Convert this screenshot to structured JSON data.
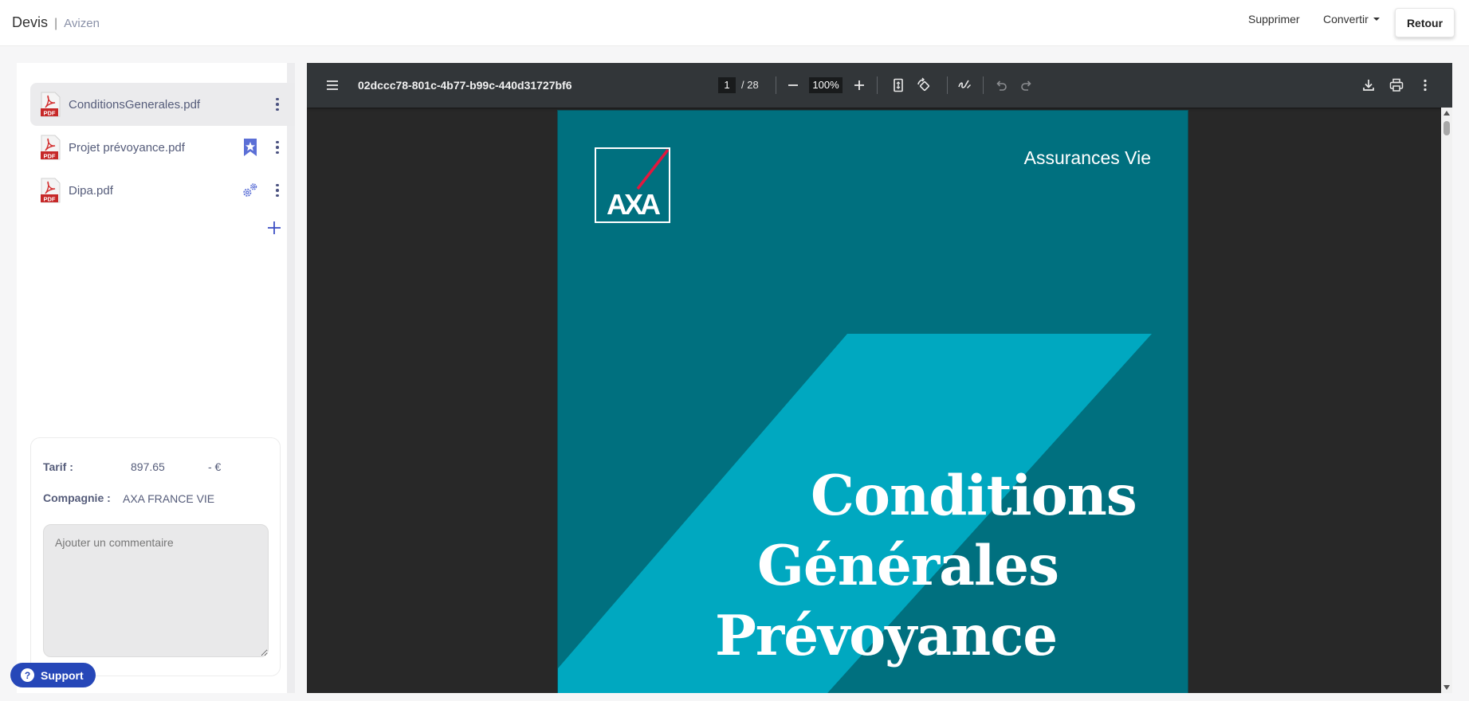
{
  "header": {
    "title": "Devis",
    "separator": "|",
    "subtitle": "Avizen",
    "delete_label": "Supprimer",
    "convert_label": "Convertir",
    "back_label": "Retour"
  },
  "files": [
    {
      "name": "ConditionsGenerales.pdf",
      "active": true,
      "status_icon": ""
    },
    {
      "name": "Projet prévoyance.pdf",
      "active": false,
      "status_icon": "bookmark-star-icon"
    },
    {
      "name": "Dipa.pdf",
      "active": false,
      "status_icon": "gears-icon"
    }
  ],
  "info": {
    "tarif_label": "Tarif :",
    "tarif_value": "897.65",
    "tarif_suffix": "- €",
    "compagnie_label": "Compagnie :",
    "compagnie_value": "AXA FRANCE VIE",
    "comment_placeholder": "Ajouter un commentaire"
  },
  "support": {
    "label": "Support",
    "icon_glyph": "?"
  },
  "viewer": {
    "doc_title": "02dccc78-801c-4b77-b99c-440d31727bf6",
    "current_page": "1",
    "total_pages": "/ 28",
    "zoom": "100%"
  },
  "page": {
    "header": "Assurances Vie",
    "title_line1": "Conditions",
    "title_line2": "Générales",
    "title_line3": "Prévoyance",
    "logo_text": "AXA",
    "bg_color": "#00707f",
    "band_color": "#00a8c0"
  },
  "colors": {
    "accent": "#2647b8",
    "link_text": "#555c7a",
    "toolbar": "#323639",
    "viewer_bg": "#282828"
  }
}
